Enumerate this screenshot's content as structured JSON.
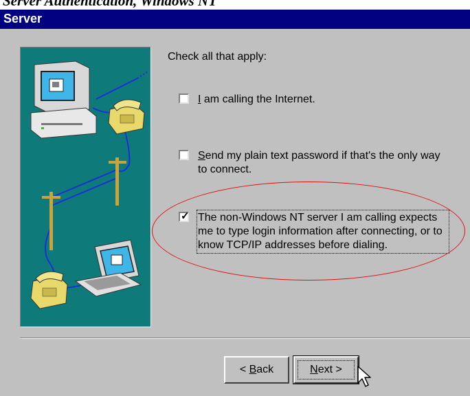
{
  "top_caption": "Server Authentication, Windows NT",
  "window": {
    "title": "Server"
  },
  "instruction": "Check all that apply:",
  "options": [
    {
      "mnemonic": "I",
      "text": " am calling the Internet.",
      "checked": false
    },
    {
      "mnemonic": "S",
      "text": "end my plain text password if that's the only way to connect.",
      "checked": false
    },
    {
      "mnemonic": "",
      "text": "The non-Windows NT server I am calling expects me to type login information after connecting, or to know TCP/IP addresses before dialing.",
      "checked": true
    }
  ],
  "checkmark_glyph": "✓",
  "buttons": {
    "back": {
      "arrow": "< ",
      "mnemonic": "B",
      "rest": "ack"
    },
    "next": {
      "mnemonic": "N",
      "rest": "ext",
      "arrow": " >"
    }
  },
  "colors": {
    "titlebar": "#000080",
    "dialog": "#c0c0c0",
    "illustration": "#0f7a7a",
    "annotation": "#e01010"
  },
  "icons": [
    "computer-icon",
    "telephone-icon",
    "utility-pole-icon",
    "laptop-icon",
    "mouse-pointer-icon"
  ]
}
